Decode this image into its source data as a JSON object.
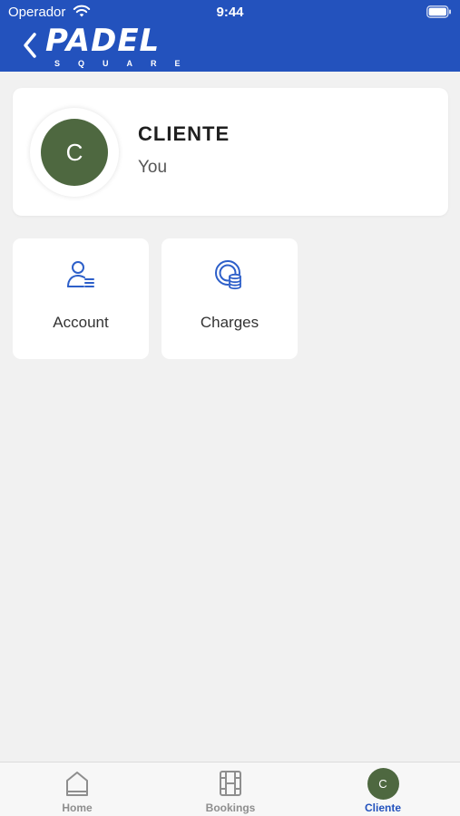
{
  "status_bar": {
    "carrier": "Operador",
    "time": "9:44"
  },
  "header": {
    "logo_main": "PADEL",
    "logo_sub": "SQUARE",
    "brand_color": "#2352bd"
  },
  "profile": {
    "initial": "C",
    "name": "CLIENTE",
    "subtitle": "You",
    "avatar_color": "#4e6840"
  },
  "tiles": [
    {
      "label": "Account",
      "icon": "account-icon"
    },
    {
      "label": "Charges",
      "icon": "charges-icon"
    }
  ],
  "tabbar": {
    "items": [
      {
        "label": "Home",
        "icon": "home-icon"
      },
      {
        "label": "Bookings",
        "icon": "bookings-icon"
      },
      {
        "label": "Cliente",
        "icon": "avatar",
        "initial": "C",
        "active": true
      }
    ]
  }
}
